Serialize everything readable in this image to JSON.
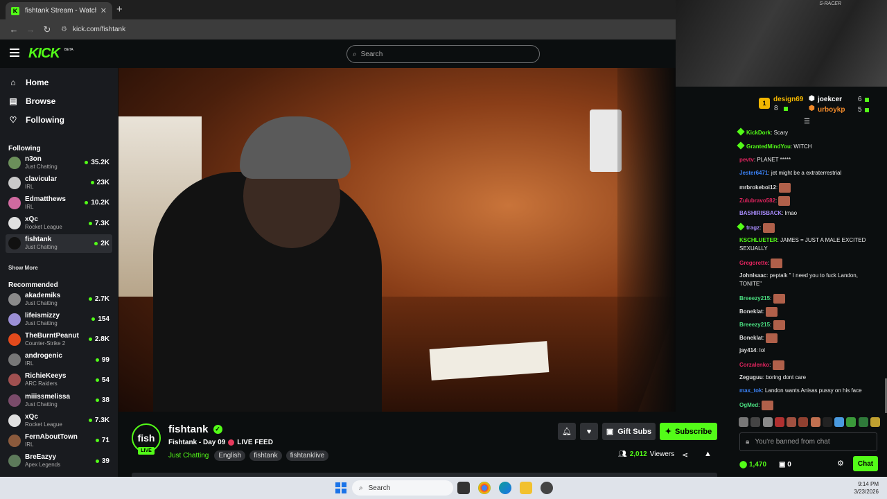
{
  "browser": {
    "tab_title": "fishtank Stream - Watch Live on Kick",
    "tab_favicon": "K",
    "tab_close": "✕",
    "new_tab": "+",
    "url": "kick.com/fishtank"
  },
  "header": {
    "logo": "KICK",
    "logo_sup": "BETA",
    "search_placeholder": "Search"
  },
  "sidebar": {
    "nav": [
      {
        "label": "Home",
        "icon": "home-icon"
      },
      {
        "label": "Browse",
        "icon": "browse-icon"
      },
      {
        "label": "Following",
        "icon": "heart-icon"
      }
    ],
    "following_title": "Following",
    "following": [
      {
        "name": "n3on",
        "category": "Just Chatting",
        "viewers": "35.2K",
        "color": "#6b8f5a"
      },
      {
        "name": "clavicular",
        "category": "IRL",
        "viewers": "23K",
        "color": "#c9c9c9"
      },
      {
        "name": "Edmatthews",
        "category": "IRL",
        "viewers": "10.2K",
        "color": "#d06aa0"
      },
      {
        "name": "xQc",
        "category": "Rocket League",
        "viewers": "7.3K",
        "color": "#e0e0e0"
      },
      {
        "name": "fishtank",
        "category": "Just Chatting",
        "viewers": "2K",
        "color": "#111111"
      }
    ],
    "show_more": "Show More",
    "recommended_title": "Recommended",
    "recommended": [
      {
        "name": "akademiks",
        "category": "Just Chatting",
        "viewers": "2.7K",
        "color": "#8a8a8a"
      },
      {
        "name": "lifeismizzy",
        "category": "Just Chatting",
        "viewers": "154",
        "color": "#9b8fd6"
      },
      {
        "name": "TheBurntPeanut",
        "category": "Counter-Strike 2",
        "viewers": "2.8K",
        "color": "#e34a1c"
      },
      {
        "name": "androgenic",
        "category": "IRL",
        "viewers": "99",
        "color": "#777777"
      },
      {
        "name": "RichieKeeys",
        "category": "ARC Raiders",
        "viewers": "54",
        "color": "#a05050"
      },
      {
        "name": "miiissmelissa",
        "category": "Just Chatting",
        "viewers": "38",
        "color": "#7a4b6a"
      },
      {
        "name": "xQc",
        "category": "Rocket League",
        "viewers": "7.3K",
        "color": "#e0e0e0"
      },
      {
        "name": "FernAboutTown",
        "category": "IRL",
        "viewers": "71",
        "color": "#8b5a3c"
      },
      {
        "name": "BreEazyy",
        "category": "Apex Legends",
        "viewers": "39",
        "color": "#5d7a5a"
      }
    ]
  },
  "stream": {
    "channel_avatar_text": "fish",
    "live_badge": "LIVE",
    "channel_name": "fishtank",
    "title": "Fishtank - Day 09",
    "title_suffix": "LIVE FEED",
    "category": "Just Chatting",
    "tags": [
      "English",
      "fishtank",
      "fishtanklive"
    ],
    "gift_label": "Gift Subs",
    "subscribe_label": "Subscribe",
    "viewers": "2,012",
    "viewers_label": "Viewers"
  },
  "chat": {
    "webcam_label": "S-RACER",
    "leaderboard": [
      {
        "rank": "1",
        "name": "design69",
        "count": "8"
      },
      {
        "name": "joekcer",
        "count": "6"
      },
      {
        "name": "urboykp",
        "count": "5"
      }
    ],
    "messages": [
      {
        "user": "KickDork",
        "text": ": Scary",
        "color": "#53fc18",
        "badge": true
      },
      {
        "user": "GrantedMindYou",
        "text": ": WITCH",
        "color": "#53fc18",
        "badge": true
      },
      {
        "user": "pevtv",
        "text": ": PLANET *****",
        "color": "#e0245e"
      },
      {
        "user": "Jester6471",
        "text": ": jet might be a extraterrestrial",
        "color": "#3b82f6"
      },
      {
        "user": "mrbrokeboi12",
        "text": ": ",
        "color": "#dddddd",
        "emote": true
      },
      {
        "user": "Zulubravo582",
        "text": ": ",
        "color": "#e0245e",
        "emote": true
      },
      {
        "user": "BASHIRISBACK",
        "text": ": lmao",
        "color": "#a78bfa"
      },
      {
        "user": "tragz",
        "text": ": ",
        "color": "#a78bfa",
        "badge": true,
        "emote": true
      },
      {
        "user": "KSCHLUETER",
        "text": ": JAMES = JUST A MALE EXCITED SEXUALLY",
        "color": "#53fc18"
      },
      {
        "user": "Gregorette",
        "text": ": ",
        "color": "#e0245e",
        "emote": true
      },
      {
        "user": "JohnIsaac",
        "text": ": peptalk \" I need you to fuck Landon, TONITE\"",
        "color": "#dddddd"
      },
      {
        "user": "Breeezy215",
        "text": ": ",
        "color": "#4ade80",
        "emote": true
      },
      {
        "user": "Boneklat",
        "text": ": ",
        "color": "#dddddd",
        "emote": true
      },
      {
        "user": "Breeezy215",
        "text": ": ",
        "color": "#4ade80",
        "emote": true
      },
      {
        "user": "Boneklat",
        "text": ": ",
        "color": "#dddddd",
        "emote": true
      },
      {
        "user": "jay414",
        "text": ": lol",
        "color": "#dddddd"
      },
      {
        "user": "Corzalenko",
        "text": ": ",
        "color": "#e0245e",
        "emote": true
      },
      {
        "user": "Zeguguu",
        "text": ": boring dont care",
        "color": "#dddddd"
      },
      {
        "user": "max_tok",
        "text": ": Landon wants Anisas pussy on his face",
        "color": "#3b82f6"
      },
      {
        "user": "OgMed",
        "text": ": ",
        "color": "#4ade80",
        "emote": true
      }
    ],
    "banned_text": "You're banned from chat",
    "points": "1,470",
    "gifts": "0",
    "chat_button": "Chat"
  },
  "taskbar": {
    "search_placeholder": "Search",
    "time": "9:14 PM",
    "date": "3/23/2026"
  }
}
